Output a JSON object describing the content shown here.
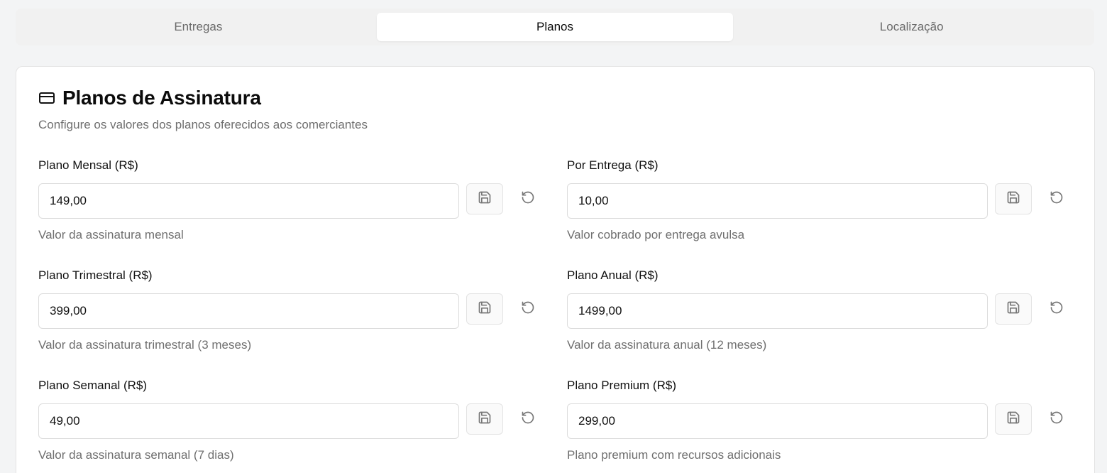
{
  "tabs": [
    {
      "label": "Entregas",
      "active": false
    },
    {
      "label": "Planos",
      "active": true
    },
    {
      "label": "Localização",
      "active": false
    }
  ],
  "card": {
    "icon": "credit-card-icon",
    "title": "Planos de Assinatura",
    "subtitle": "Configure os valores dos planos oferecidos aos comerciantes"
  },
  "fields": [
    {
      "label": "Plano Mensal (R$)",
      "value": "149,00",
      "help": "Valor da assinatura mensal"
    },
    {
      "label": "Por Entrega (R$)",
      "value": "10,00",
      "help": "Valor cobrado por entrega avulsa"
    },
    {
      "label": "Plano Trimestral (R$)",
      "value": "399,00",
      "help": "Valor da assinatura trimestral (3 meses)"
    },
    {
      "label": "Plano Anual (R$)",
      "value": "1499,00",
      "help": "Valor da assinatura anual (12 meses)"
    },
    {
      "label": "Plano Semanal (R$)",
      "value": "49,00",
      "help": "Valor da assinatura semanal (7 dias)"
    },
    {
      "label": "Plano Premium (R$)",
      "value": "299,00",
      "help": "Plano premium com recursos adicionais"
    }
  ],
  "icons": {
    "save": "save-icon",
    "reset": "reset-icon"
  },
  "colors": {
    "background": "#f3f4f5",
    "card": "#ffffff",
    "muted_text": "#6f6f6f",
    "border": "#dcdcdc"
  }
}
